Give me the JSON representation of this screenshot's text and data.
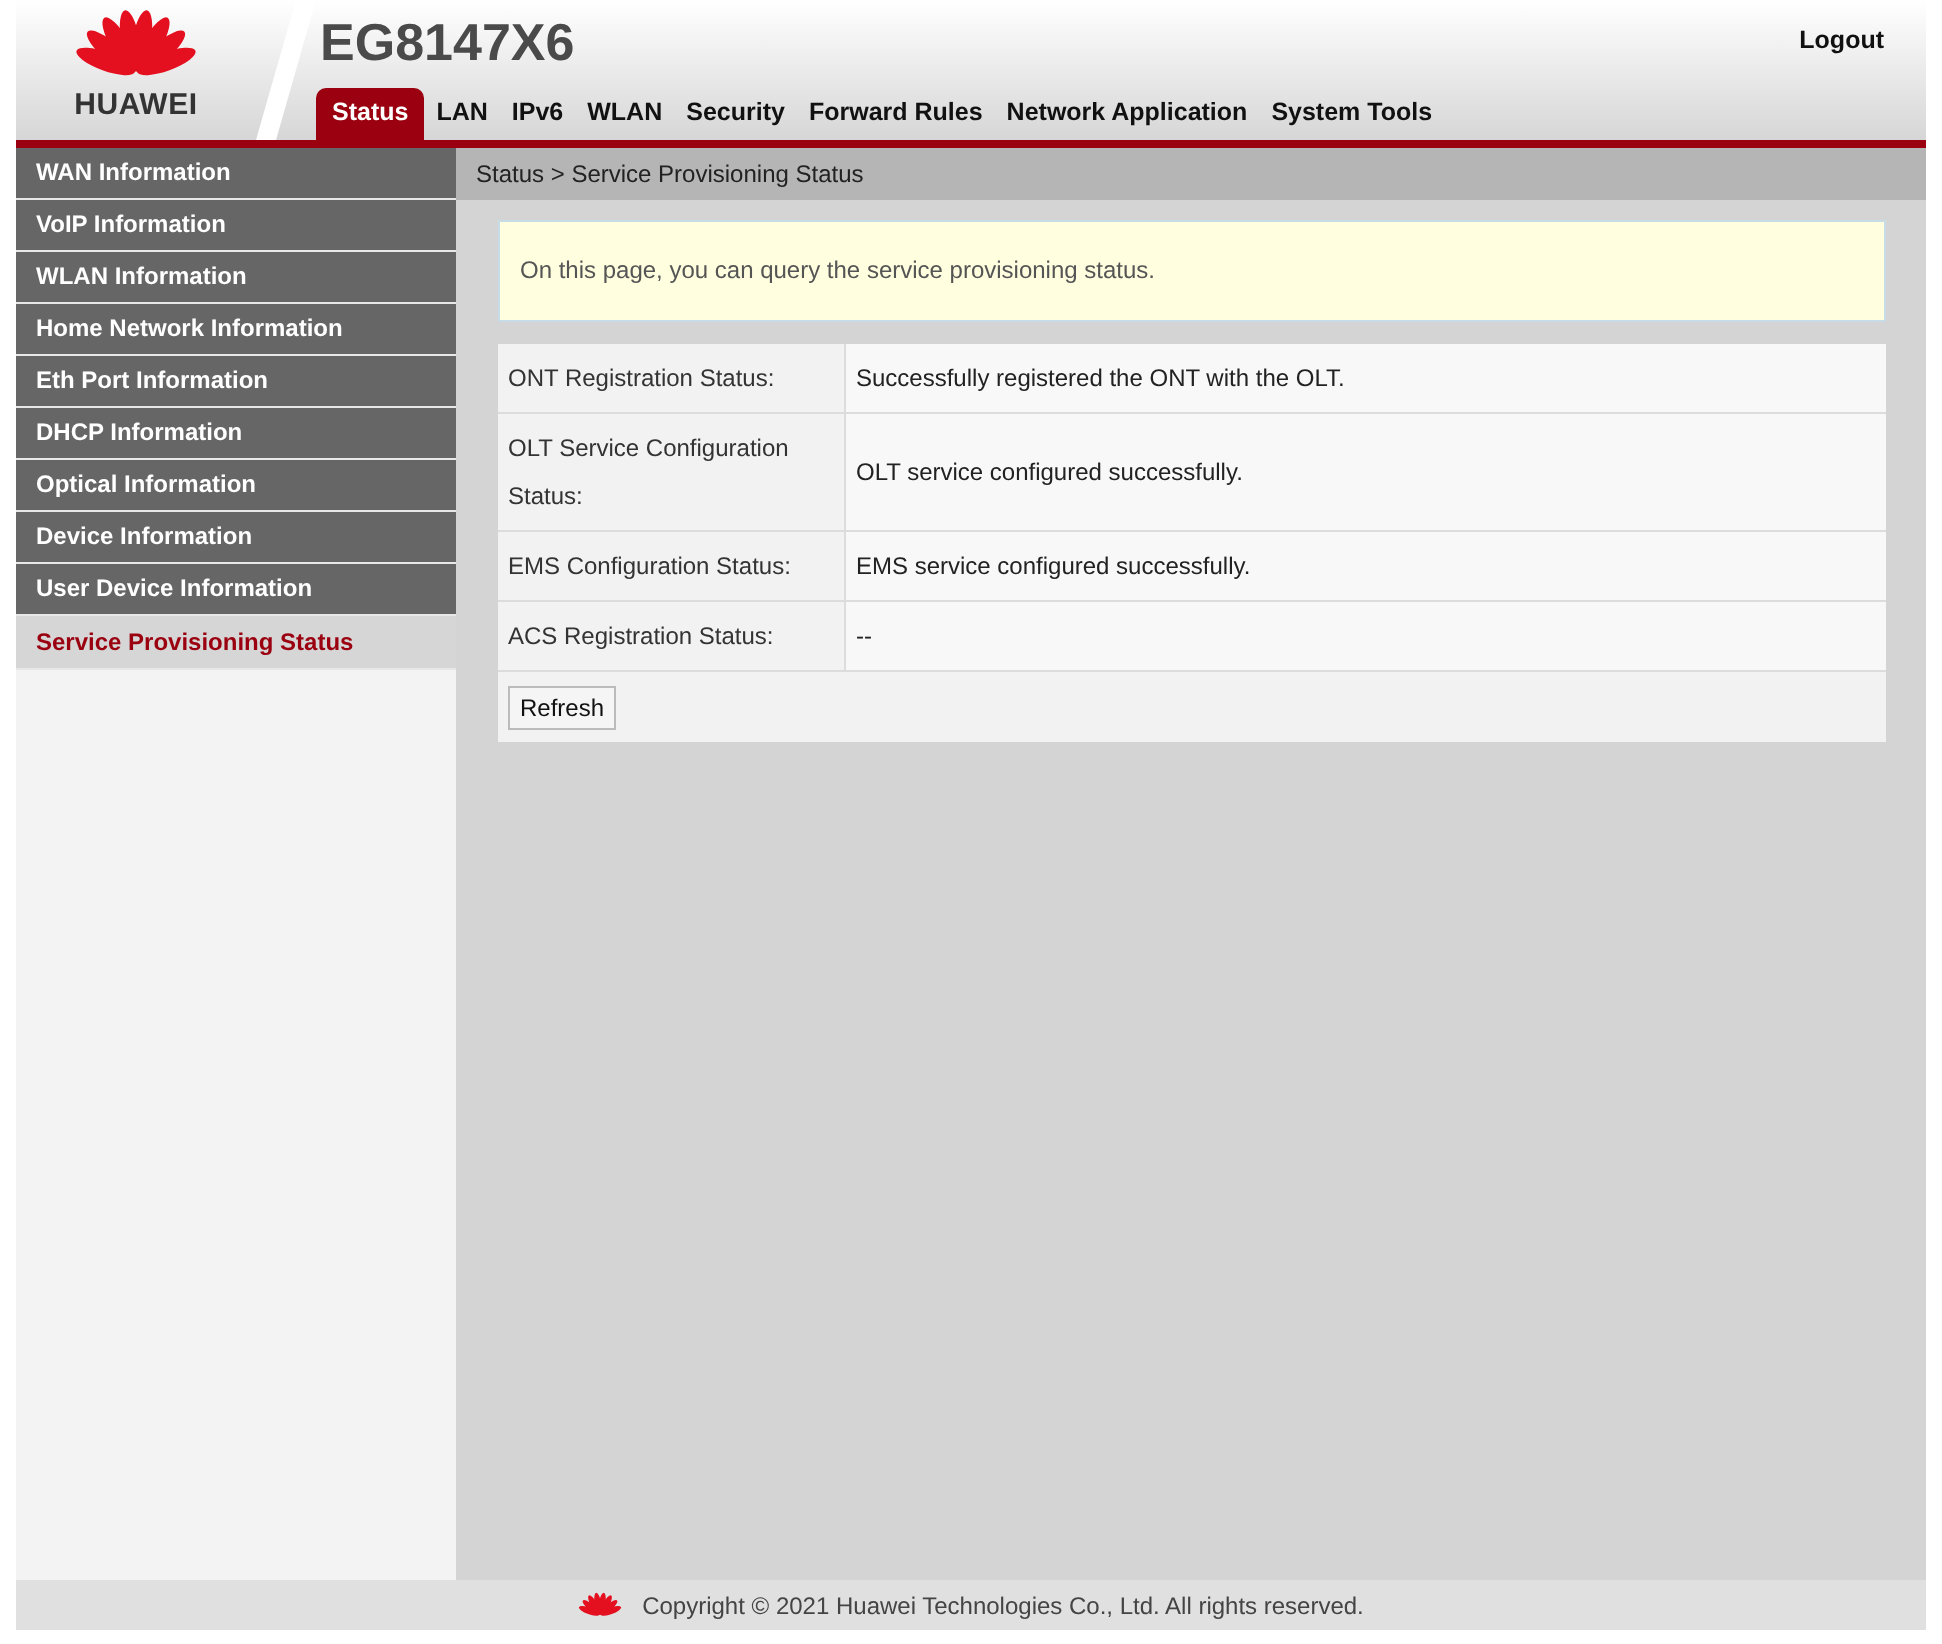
{
  "header": {
    "brand": "HUAWEI",
    "title": "EG8147X6",
    "logout": "Logout"
  },
  "tabs": [
    {
      "label": "Status",
      "selected": true
    },
    {
      "label": "LAN",
      "selected": false
    },
    {
      "label": "IPv6",
      "selected": false
    },
    {
      "label": "WLAN",
      "selected": false
    },
    {
      "label": "Security",
      "selected": false
    },
    {
      "label": "Forward Rules",
      "selected": false
    },
    {
      "label": "Network Application",
      "selected": false
    },
    {
      "label": "System Tools",
      "selected": false
    }
  ],
  "sidebar": {
    "items": [
      {
        "label": "WAN Information",
        "selected": false
      },
      {
        "label": "VoIP Information",
        "selected": false
      },
      {
        "label": "WLAN Information",
        "selected": false
      },
      {
        "label": "Home Network Information",
        "selected": false
      },
      {
        "label": "Eth Port Information",
        "selected": false
      },
      {
        "label": "DHCP Information",
        "selected": false
      },
      {
        "label": "Optical Information",
        "selected": false
      },
      {
        "label": "Device Information",
        "selected": false
      },
      {
        "label": "User Device Information",
        "selected": false
      },
      {
        "label": "Service Provisioning Status",
        "selected": true
      }
    ]
  },
  "breadcrumb": "Status > Service Provisioning Status",
  "notice": "On this page, you can query the service provisioning status.",
  "status_table": {
    "rows": [
      {
        "label": "ONT Registration Status:",
        "value": "Successfully registered the ONT with the OLT."
      },
      {
        "label": "OLT Service Configuration Status:",
        "value": "OLT service configured successfully."
      },
      {
        "label": "EMS Configuration Status:",
        "value": "EMS service configured successfully."
      },
      {
        "label": "ACS Registration Status:",
        "value": "--"
      }
    ]
  },
  "buttons": [
    "Refresh"
  ],
  "footer": {
    "copyright": "Copyright © 2021 Huawei Technologies Co., Ltd. All rights reserved."
  }
}
